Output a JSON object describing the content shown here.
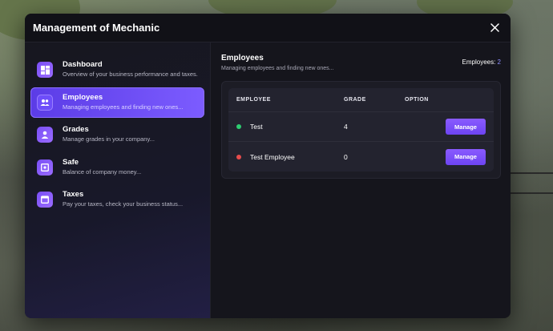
{
  "window": {
    "title": "Management of Mechanic"
  },
  "sidebar": {
    "items": [
      {
        "label": "Dashboard",
        "desc": "Overview of your business performance and taxes.",
        "icon": "dashboard-icon",
        "active": false
      },
      {
        "label": "Employees",
        "desc": "Managing employees and finding new ones...",
        "icon": "users-icon",
        "active": true
      },
      {
        "label": "Grades",
        "desc": "Manage grades in your company...",
        "icon": "user-icon",
        "active": false
      },
      {
        "label": "Safe",
        "desc": "Balance of company money...",
        "icon": "safe-icon",
        "active": false
      },
      {
        "label": "Taxes",
        "desc": "Pay your taxes, check your business status...",
        "icon": "calendar-icon",
        "active": false
      }
    ]
  },
  "main": {
    "title": "Employees",
    "subtitle": "Managing employees and finding new ones...",
    "count_label": "Employees:",
    "count_value": "2"
  },
  "table": {
    "columns": [
      "EMPLOYEE",
      "GRADE",
      "OPTION"
    ],
    "rows": [
      {
        "name": "Test",
        "grade": "4",
        "status": "online",
        "status_color": "#2ecc71",
        "action": "Manage"
      },
      {
        "name": "Test Employee",
        "grade": "0",
        "status": "offline",
        "status_color": "#e74c4c",
        "action": "Manage"
      }
    ]
  },
  "colors": {
    "accent": "#7c5cff",
    "panel": "#15151c"
  }
}
